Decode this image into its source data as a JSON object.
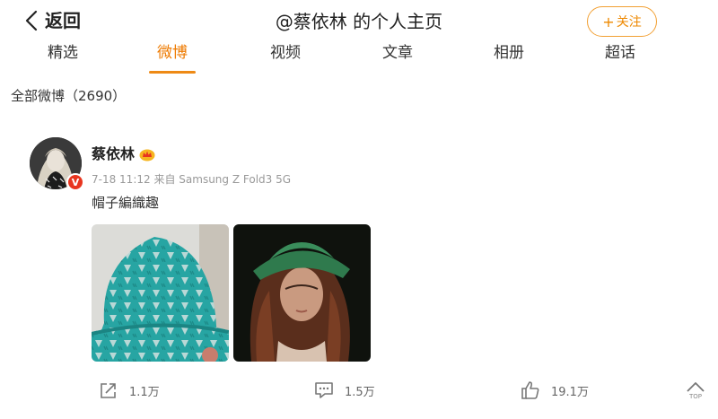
{
  "header": {
    "back_label": "返回",
    "title": "@蔡依林 的个人主页",
    "follow_label": "关注"
  },
  "tabs": [
    {
      "label": "精选",
      "active": false
    },
    {
      "label": "微博",
      "active": true
    },
    {
      "label": "视频",
      "active": false
    },
    {
      "label": "文章",
      "active": false
    },
    {
      "label": "相册",
      "active": false
    },
    {
      "label": "超话",
      "active": false
    }
  ],
  "feed": {
    "count_label": "全部微博（2690）"
  },
  "post": {
    "author": "蔡依林",
    "verified_badge": "V",
    "time": "7-18 11:12",
    "source": "来自 Samsung Z Fold3 5G",
    "text": "帽子編織趣",
    "images": [
      "teal crochet bucket hat",
      "woman wearing green crochet hat"
    ],
    "stats": {
      "reposts": "1.1万",
      "comments": "1.5万",
      "likes": "19.1万"
    }
  },
  "back_to_top": "TOP",
  "colors": {
    "accent": "#ee7a00",
    "follow_border": "#f2a033",
    "verified": "#e8351f"
  }
}
